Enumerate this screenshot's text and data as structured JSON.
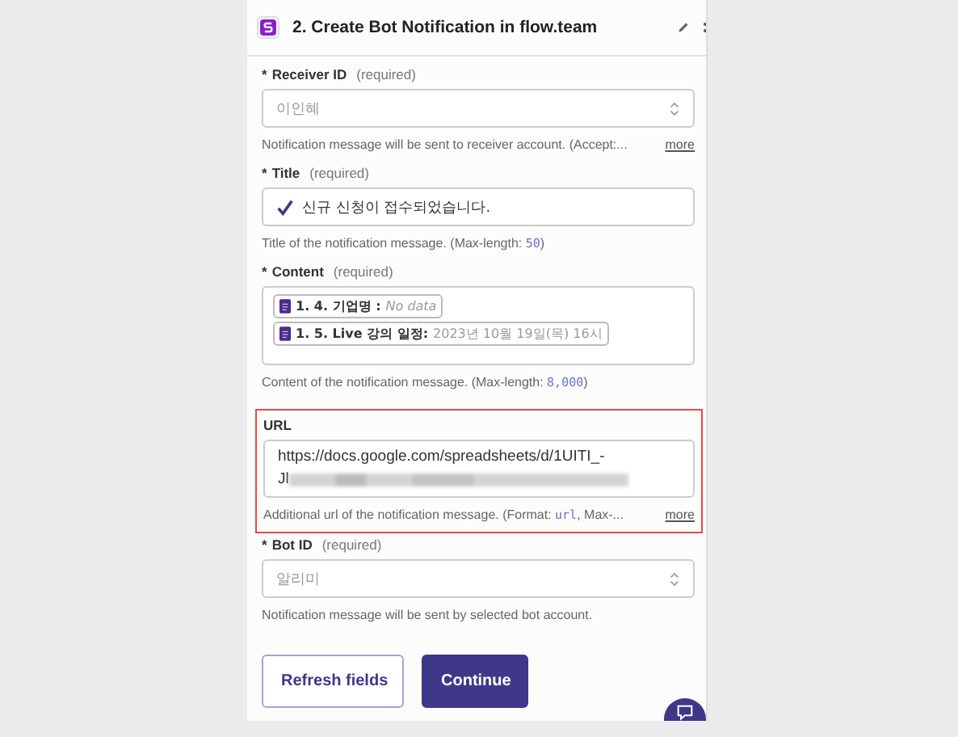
{
  "header": {
    "title": "2. Create Bot Notification in flow.team"
  },
  "fields": [
    {
      "kind": "select",
      "label": "Receiver ID",
      "required_mark": "*",
      "required_note": "(required)",
      "value": "이인혜",
      "hint": "Notification message will be sent to receiver account. (Accept:...",
      "more": "more",
      "highlighted": false
    },
    {
      "kind": "text",
      "label": "Title",
      "required_mark": "*",
      "required_note": "(required)",
      "value": "신규 신청이 접수되었습니다.",
      "checkmark": true,
      "hint": "Title of the notification message. (Max-length: ",
      "hint_code": "50",
      "hint_end": ")",
      "highlighted": false
    },
    {
      "kind": "tokens",
      "label": "Content",
      "required_mark": "*",
      "required_note": "(required)",
      "tokens": [
        {
          "label": "1. 4. 기업명 :",
          "value": "No data",
          "empty": true
        },
        {
          "label": "1. 5. Live 강의 일정:",
          "value": "2023년 10월 19일(목) 16시",
          "empty": false
        }
      ],
      "hint": "Content of the notification message. (Max-length: ",
      "hint_code": "8,000",
      "hint_end": ")",
      "highlighted": false
    },
    {
      "kind": "textarea",
      "label": "URL",
      "lines": [
        "https://docs.google.com/spreadsheets/d/1UITI_-",
        "Jl"
      ],
      "redacted": true,
      "hint": "Additional url of the notification message. (Format: ",
      "hint_code": "url",
      "hint_end": ", Max-...",
      "more": "more",
      "highlighted": true
    },
    {
      "kind": "select",
      "label": "Bot ID",
      "required_mark": "*",
      "required_note": "(required)",
      "value": "알리미",
      "hint": "Notification message will be sent by selected bot account.",
      "highlighted": false
    }
  ],
  "buttons": [
    {
      "label": "Refresh fields",
      "primary": false
    },
    {
      "label": "Continue",
      "primary": true
    }
  ]
}
